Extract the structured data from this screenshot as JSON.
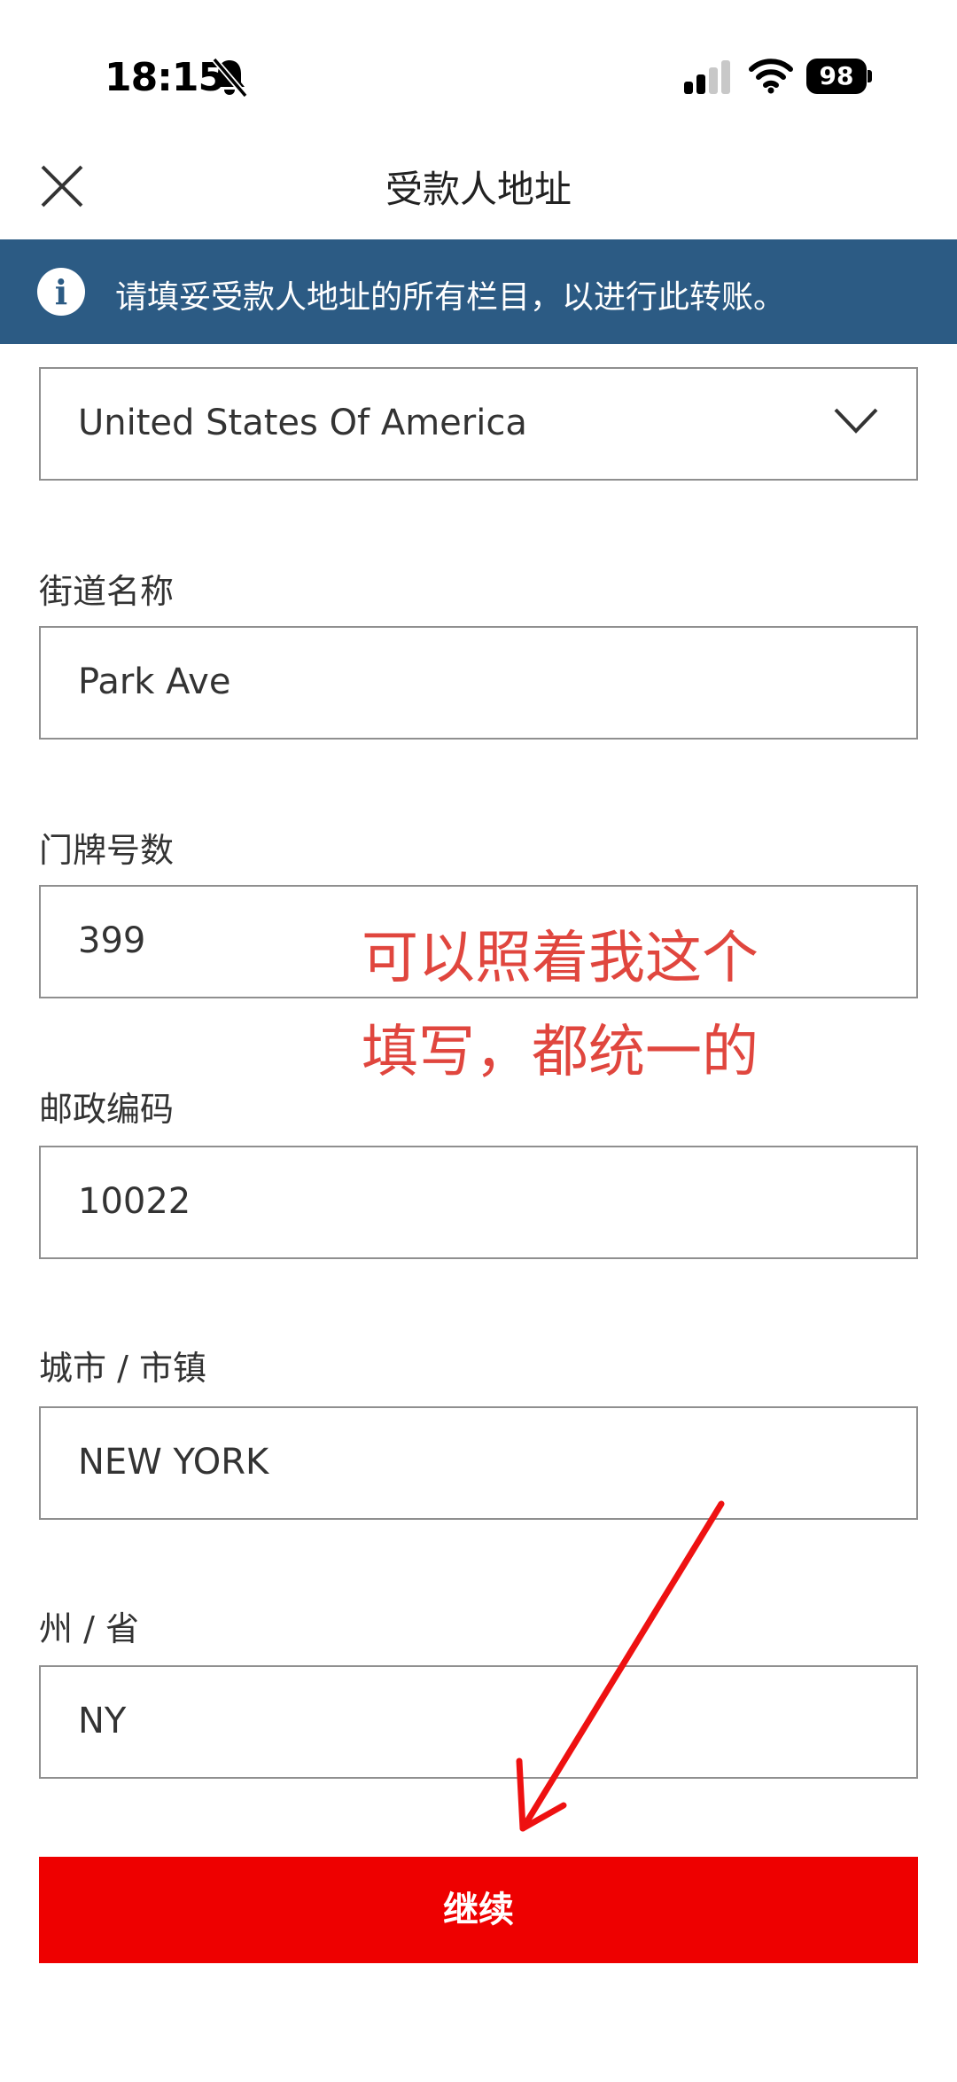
{
  "status_bar": {
    "time": "18:15",
    "battery": "98",
    "icons": [
      "bell-slash-icon",
      "cellular-signal-icon",
      "wifi-icon",
      "battery-icon"
    ]
  },
  "header": {
    "title": "受款人地址",
    "close_icon": "close-icon"
  },
  "info_banner": {
    "icon": "info-icon",
    "text": "请填妥受款人地址的所有栏目，以进行此转账。"
  },
  "form": {
    "country": {
      "value": "United States Of America",
      "icon": "chevron-down-icon"
    },
    "street": {
      "label": "街道名称",
      "value": "Park Ave"
    },
    "house_number": {
      "label": "门牌号数",
      "value": "399"
    },
    "postal_code": {
      "label": "邮政编码",
      "value": "10022"
    },
    "city": {
      "label": "城市 / 市镇",
      "value": "NEW YORK"
    },
    "state": {
      "label": "州 / 省",
      "value": "NY"
    }
  },
  "annotation": {
    "line1": "可以照着我这个",
    "line2": "填写，都统一的",
    "color": "#e0463e",
    "arrow_color": "#ee1111"
  },
  "continue_button": {
    "label": "继续",
    "color": "#ee0000"
  },
  "colors": {
    "banner": "#2c5b84",
    "border": "#8f8f8f"
  }
}
